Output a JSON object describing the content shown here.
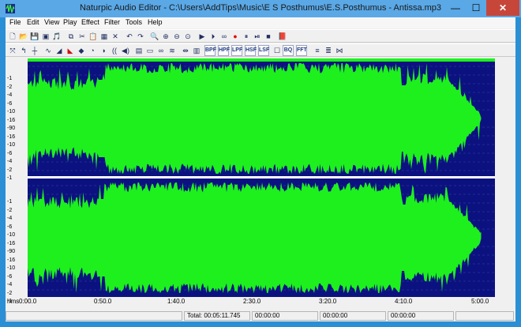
{
  "window": {
    "title": "Naturpic Audio Editor - C:\\Users\\AddTips\\Music\\E S Posthumus\\E.S.Posthumus - Antissa.mp3",
    "min_glyph": "—",
    "max_glyph": "☐",
    "close_glyph": "✕"
  },
  "menu": [
    "File",
    "Edit",
    "View",
    "Play",
    "Effect",
    "Filter",
    "Tools",
    "Help"
  ],
  "toolbar1": [
    {
      "name": "new-file-icon",
      "glyph": "🗋"
    },
    {
      "name": "open-folder-icon",
      "glyph": "📂"
    },
    {
      "name": "save-icon",
      "glyph": "💾"
    },
    {
      "name": "save-as-icon",
      "glyph": "▣"
    },
    {
      "name": "properties-icon",
      "glyph": "🎵"
    },
    {
      "name": "copy-icon",
      "glyph": "⧉"
    },
    {
      "name": "cut-icon",
      "glyph": "✂"
    },
    {
      "name": "paste-icon",
      "glyph": "📋"
    },
    {
      "name": "mix-paste-icon",
      "glyph": "▦"
    },
    {
      "name": "delete-icon",
      "glyph": "✕"
    },
    {
      "name": "undo-icon",
      "glyph": "↶"
    },
    {
      "name": "redo-icon",
      "glyph": "↷"
    },
    {
      "name": "zoom-in-icon",
      "glyph": "🔍"
    },
    {
      "name": "zoom-selection-icon",
      "glyph": "⊕"
    },
    {
      "name": "zoom-out-icon",
      "glyph": "⊖"
    },
    {
      "name": "zoom-all-icon",
      "glyph": "⊙"
    },
    {
      "name": "play-icon",
      "glyph": "▶"
    },
    {
      "name": "play-selection-icon",
      "glyph": "⏵"
    },
    {
      "name": "loop-icon",
      "glyph": "∞"
    },
    {
      "name": "record-icon",
      "glyph": "●"
    },
    {
      "name": "pause-icon",
      "glyph": "⏸"
    },
    {
      "name": "stop-play-icon",
      "glyph": "⏯"
    },
    {
      "name": "stop-icon",
      "glyph": "■"
    },
    {
      "name": "book-icon",
      "glyph": "📕"
    }
  ],
  "toolbar2": [
    {
      "name": "normalize-icon",
      "glyph": "⤧",
      "text": false
    },
    {
      "name": "reverse-icon",
      "glyph": "↰",
      "text": false
    },
    {
      "name": "silence-icon",
      "glyph": "┼",
      "text": false
    },
    {
      "name": "amplify-icon",
      "glyph": "∿",
      "text": false
    },
    {
      "name": "fade-in-icon",
      "glyph": "◢",
      "text": false
    },
    {
      "name": "fade-out-icon",
      "glyph": "◣",
      "text": false
    },
    {
      "name": "fade-icon",
      "glyph": "◆",
      "text": false
    },
    {
      "name": "echo-icon",
      "glyph": "◔",
      "text": false
    },
    {
      "name": "reverb-icon",
      "glyph": "◑",
      "text": false
    },
    {
      "name": "chorus-icon",
      "glyph": "((",
      "text": false
    },
    {
      "name": "flanger-icon",
      "glyph": "◀)",
      "text": false
    },
    {
      "name": "compressor-icon",
      "glyph": "▤",
      "text": false
    },
    {
      "name": "envelope-icon",
      "glyph": "▭",
      "text": false
    },
    {
      "name": "pitch-icon",
      "glyph": "∞",
      "text": false
    },
    {
      "name": "tempo-icon",
      "glyph": "≋",
      "text": false
    },
    {
      "name": "insert-silence-icon",
      "glyph": "⇹",
      "text": false
    },
    {
      "name": "equalizer-icon",
      "glyph": "▥",
      "text": false
    },
    {
      "name": "bpf-icon",
      "glyph": "BPF",
      "text": true
    },
    {
      "name": "hpf-icon",
      "glyph": "HPF",
      "text": true
    },
    {
      "name": "lpf-icon",
      "glyph": "LPF",
      "text": true
    },
    {
      "name": "hsf-icon",
      "glyph": "HSF",
      "text": true
    },
    {
      "name": "lsf-icon",
      "glyph": "LSF",
      "text": true
    },
    {
      "name": "graphic-eq-icon",
      "glyph": "☐",
      "text": false
    },
    {
      "name": "bq-icon",
      "glyph": "BQ",
      "text": true
    },
    {
      "name": "fft-icon",
      "glyph": "FFT",
      "text": true
    },
    {
      "name": "spectrum-icon",
      "glyph": "≡",
      "text": false
    },
    {
      "name": "noise-icon",
      "glyph": "≣",
      "text": false
    },
    {
      "name": "vocal-remove-icon",
      "glyph": "⋈",
      "text": false
    }
  ],
  "ylabels": [
    "-1",
    "-2",
    "-4",
    "-6",
    "-10",
    "-16",
    "-90",
    "-16",
    "-10",
    "-6",
    "-4",
    "-2",
    "-1"
  ],
  "time_labels": [
    "hms",
    "0:00.0",
    "0:50.0",
    "1:40.0",
    "2:30.0",
    "3:20.0",
    "4:10.0",
    "5:00.0"
  ],
  "status": {
    "total": "Total: 00:05:11.745",
    "sel_start": "00:00:00",
    "sel_end": "00:00:00",
    "sel_length": "00:00:00"
  },
  "colors": {
    "background": "#0c1180",
    "wave": "#1ef01e",
    "grid": "#2b4aa0"
  }
}
